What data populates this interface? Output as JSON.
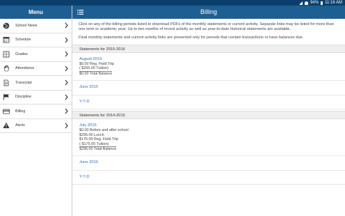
{
  "statusbar": {
    "battery": "94%",
    "time": "11:16 AM"
  },
  "sidebar": {
    "title": "Menu",
    "items": [
      {
        "label": "School News",
        "icon": "globe-icon"
      },
      {
        "label": "Schedule",
        "icon": "calendar-icon"
      },
      {
        "label": "Grades",
        "icon": "grades-icon"
      },
      {
        "label": "Attendance",
        "icon": "hand-icon"
      },
      {
        "label": "Transcript",
        "icon": "document-icon"
      },
      {
        "label": "Discipline",
        "icon": "flag-icon"
      },
      {
        "label": "Billing",
        "icon": "card-icon"
      },
      {
        "label": "Alerts",
        "icon": "warning-icon"
      }
    ]
  },
  "header": {
    "title": "Billing"
  },
  "intro": {
    "p1": "Click on any of the billing periods listed to download PDFs of the monthly statements or current activity. Separate links may be listed for more than one term or academic year. Up to two months of recent activity as well as year-to-date historical statements are available.",
    "p2": "Final monthly statements and current activity links are presented only for periods that contain transactions or have balances due."
  },
  "sections": [
    {
      "title": "Statements for 2015-2016",
      "periods": [
        {
          "label": "August 2015",
          "lines": [
            "$0.00 Reg. Field Trip",
            "( $265.00 Tuition)"
          ],
          "total": "$0.00 Total Balance"
        },
        {
          "label": "June 2015",
          "lines": [],
          "total": ""
        },
        {
          "label": "Y-T-D",
          "lines": [],
          "total": ""
        }
      ]
    },
    {
      "title": "Statements for 2014-2015",
      "periods": [
        {
          "label": "July 2015",
          "lines": [
            "$0.00 Before and after school",
            "$295.00 Lunch",
            "$176.00 Reg. Field Trip",
            "(-$175.00 Tuition)"
          ],
          "total": "$296.00 Total Balance"
        },
        {
          "label": "June 2015",
          "lines": [],
          "total": ""
        },
        {
          "label": "Y-T-D",
          "lines": [],
          "total": ""
        }
      ]
    }
  ]
}
